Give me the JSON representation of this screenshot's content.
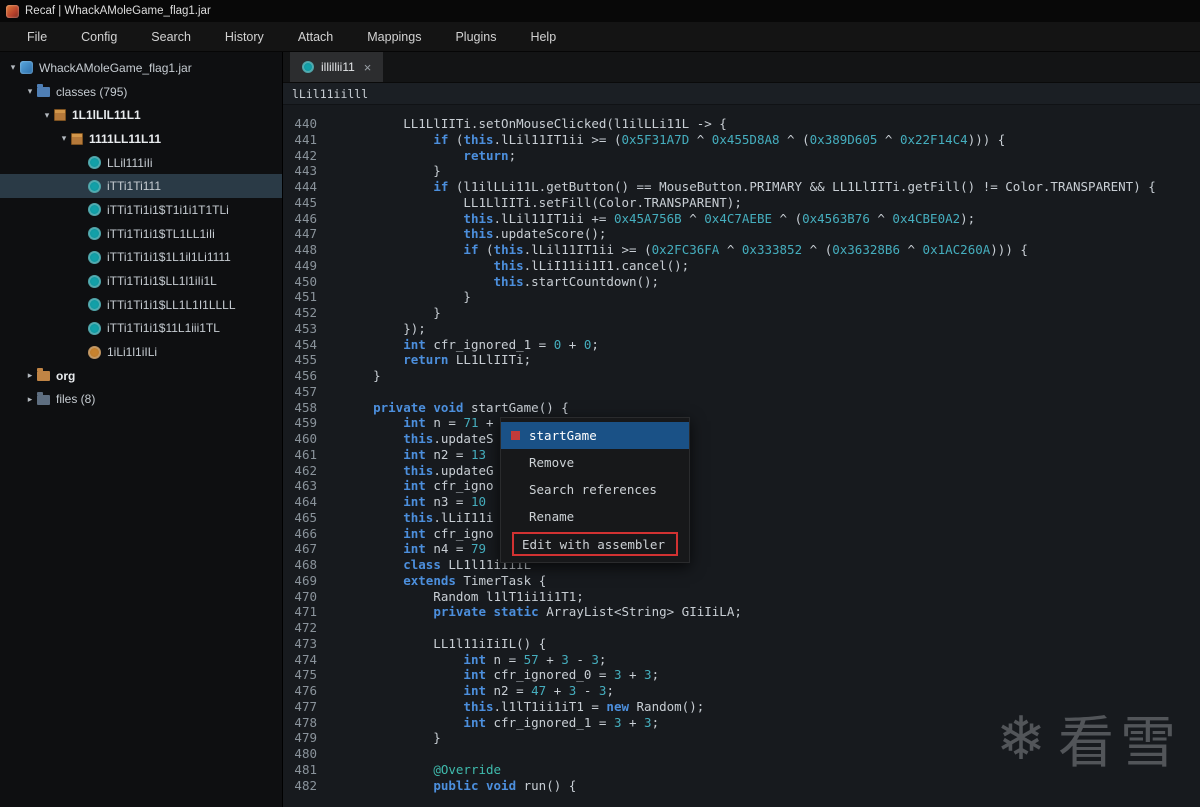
{
  "titlebar": {
    "title": "Recaf | WhackAMoleGame_flag1.jar"
  },
  "menubar": {
    "items": [
      "File",
      "Config",
      "Search",
      "History",
      "Attach",
      "Mappings",
      "Plugins",
      "Help"
    ]
  },
  "icons": {
    "expanded": "▾",
    "collapsed": "▸",
    "tab_close": "×"
  },
  "sidebar": {
    "items": [
      {
        "label": "WhackAMoleGame_flag1.jar",
        "level": 0,
        "icon": "jar",
        "state": "expanded"
      },
      {
        "label": "classes (795)",
        "level": 1,
        "icon": "folder-classes",
        "state": "expanded"
      },
      {
        "label": "1L1lLlL11L1",
        "level": 2,
        "icon": "package",
        "state": "expanded",
        "bold": true
      },
      {
        "label": "1111LL11L11",
        "level": 3,
        "icon": "package",
        "state": "expanded",
        "bold": true
      },
      {
        "label": "LLil111iIi",
        "level": 4,
        "icon": "class"
      },
      {
        "label": "iTTi1Ti111",
        "level": 4,
        "icon": "class",
        "selected": true
      },
      {
        "label": "iTTi1Ti1i1$T1i1i1T1TLi",
        "level": 4,
        "icon": "class"
      },
      {
        "label": "iTTi1Ti1i1$TL1LL1iIi",
        "level": 4,
        "icon": "class"
      },
      {
        "label": "iTTi1Ti1i1$1L1il1Li1111",
        "level": 4,
        "icon": "class"
      },
      {
        "label": "iTTi1Ti1i1$LL1l1iIi1L",
        "level": 4,
        "icon": "class"
      },
      {
        "label": "iTTi1Ti1i1$LL1L1I1LLLL",
        "level": 4,
        "icon": "class"
      },
      {
        "label": "iTTi1Ti1i1$11L1iii1TL",
        "level": 4,
        "icon": "class"
      },
      {
        "label": "1iLi1l1iILi",
        "level": 4,
        "icon": "class-orange"
      },
      {
        "label": "org",
        "level": 1,
        "icon": "folder-org",
        "state": "collapsed",
        "bold": true
      },
      {
        "label": "files (8)",
        "level": 1,
        "icon": "folder-files",
        "state": "collapsed"
      }
    ]
  },
  "tab": {
    "label": "illillii11"
  },
  "breadcrumb": {
    "path": "lLil11iilll"
  },
  "editor": {
    "lines": [
      {
        "n": 440,
        "t": [
          [
            "p",
            "        LL1LlIITi.setOnMouseClicked(l1ilLLi11L -> {"
          ]
        ]
      },
      {
        "n": 441,
        "t": [
          [
            "p",
            "            "
          ],
          [
            "k",
            "if"
          ],
          [
            "p",
            " ("
          ],
          [
            "k",
            "this"
          ],
          [
            "p",
            ".lLil11IT1ii >= ("
          ],
          [
            "n",
            "0x5F31A7D"
          ],
          [
            "p",
            " ^ "
          ],
          [
            "n",
            "0x455D8A8"
          ],
          [
            "p",
            " ^ ("
          ],
          [
            "n",
            "0x389D605"
          ],
          [
            "p",
            " ^ "
          ],
          [
            "n",
            "0x22F14C4"
          ],
          [
            "p",
            "))) {"
          ]
        ]
      },
      {
        "n": 442,
        "t": [
          [
            "p",
            "                "
          ],
          [
            "k",
            "return"
          ],
          [
            "p",
            ";"
          ]
        ]
      },
      {
        "n": 443,
        "t": [
          [
            "p",
            "            }"
          ]
        ]
      },
      {
        "n": 444,
        "t": [
          [
            "p",
            "            "
          ],
          [
            "k",
            "if"
          ],
          [
            "p",
            " (l1ilLLi11L.getButton() == MouseButton.PRIMARY && LL1LlIITi.getFill() != Color.TRANSPARENT) {"
          ]
        ]
      },
      {
        "n": 445,
        "t": [
          [
            "p",
            "                LL1LlIITi.setFill(Color.TRANSPARENT);"
          ]
        ]
      },
      {
        "n": 446,
        "t": [
          [
            "p",
            "                "
          ],
          [
            "k",
            "this"
          ],
          [
            "p",
            ".lLil11IT1ii += "
          ],
          [
            "n",
            "0x45A756B"
          ],
          [
            "p",
            " ^ "
          ],
          [
            "n",
            "0x4C7AEBE"
          ],
          [
            "p",
            " ^ ("
          ],
          [
            "n",
            "0x4563B76"
          ],
          [
            "p",
            " ^ "
          ],
          [
            "n",
            "0x4CBE0A2"
          ],
          [
            "p",
            ");"
          ]
        ]
      },
      {
        "n": 447,
        "t": [
          [
            "p",
            "                "
          ],
          [
            "k",
            "this"
          ],
          [
            "p",
            ".updateScore();"
          ]
        ]
      },
      {
        "n": 448,
        "t": [
          [
            "p",
            "                "
          ],
          [
            "k",
            "if"
          ],
          [
            "p",
            " ("
          ],
          [
            "k",
            "this"
          ],
          [
            "p",
            ".lLil11IT1ii >= ("
          ],
          [
            "n",
            "0x2FC36FA"
          ],
          [
            "p",
            " ^ "
          ],
          [
            "n",
            "0x333852"
          ],
          [
            "p",
            " ^ ("
          ],
          [
            "n",
            "0x36328B6"
          ],
          [
            "p",
            " ^ "
          ],
          [
            "n",
            "0x1AC260A"
          ],
          [
            "p",
            "))) {"
          ]
        ]
      },
      {
        "n": 449,
        "t": [
          [
            "p",
            "                    "
          ],
          [
            "k",
            "this"
          ],
          [
            "p",
            ".lLiI11ii1I1.cancel();"
          ]
        ]
      },
      {
        "n": 450,
        "t": [
          [
            "p",
            "                    "
          ],
          [
            "k",
            "this"
          ],
          [
            "p",
            ".startCountdown();"
          ]
        ]
      },
      {
        "n": 451,
        "t": [
          [
            "p",
            "                }"
          ]
        ]
      },
      {
        "n": 452,
        "t": [
          [
            "p",
            "            }"
          ]
        ]
      },
      {
        "n": 453,
        "t": [
          [
            "p",
            "        });"
          ]
        ]
      },
      {
        "n": 454,
        "t": [
          [
            "p",
            "        "
          ],
          [
            "k",
            "int"
          ],
          [
            "p",
            " cfr_ignored_1 = "
          ],
          [
            "n",
            "0"
          ],
          [
            "p",
            " + "
          ],
          [
            "n",
            "0"
          ],
          [
            "p",
            ";"
          ]
        ]
      },
      {
        "n": 455,
        "t": [
          [
            "p",
            "        "
          ],
          [
            "k",
            "return"
          ],
          [
            "p",
            " LL1LlIITi;"
          ]
        ]
      },
      {
        "n": 456,
        "t": [
          [
            "p",
            "    }"
          ]
        ]
      },
      {
        "n": 457,
        "t": []
      },
      {
        "n": 458,
        "t": [
          [
            "p",
            "    "
          ],
          [
            "k",
            "private"
          ],
          [
            "p",
            " "
          ],
          [
            "k",
            "void"
          ],
          [
            "p",
            " startGame() {"
          ]
        ]
      },
      {
        "n": 459,
        "t": [
          [
            "p",
            "        "
          ],
          [
            "k",
            "int"
          ],
          [
            "p",
            " n = "
          ],
          [
            "n",
            "71"
          ],
          [
            "p",
            " + "
          ]
        ]
      },
      {
        "n": 460,
        "t": [
          [
            "p",
            "        "
          ],
          [
            "k",
            "this"
          ],
          [
            "p",
            ".updateS"
          ]
        ]
      },
      {
        "n": 461,
        "t": [
          [
            "p",
            "        "
          ],
          [
            "k",
            "int"
          ],
          [
            "p",
            " n2 = "
          ],
          [
            "n",
            "13"
          ]
        ]
      },
      {
        "n": 462,
        "t": [
          [
            "p",
            "        "
          ],
          [
            "k",
            "this"
          ],
          [
            "p",
            ".updateG"
          ]
        ]
      },
      {
        "n": 463,
        "t": [
          [
            "p",
            "        "
          ],
          [
            "k",
            "int"
          ],
          [
            "p",
            " cfr_igno"
          ]
        ]
      },
      {
        "n": 464,
        "t": [
          [
            "p",
            "        "
          ],
          [
            "k",
            "int"
          ],
          [
            "p",
            " n3 = "
          ],
          [
            "n",
            "10"
          ]
        ]
      },
      {
        "n": 465,
        "t": [
          [
            "p",
            "        "
          ],
          [
            "k",
            "this"
          ],
          [
            "p",
            ".lLiI11i"
          ]
        ]
      },
      {
        "n": 466,
        "t": [
          [
            "p",
            "        "
          ],
          [
            "k",
            "int"
          ],
          [
            "p",
            " cfr_igno"
          ]
        ]
      },
      {
        "n": 467,
        "t": [
          [
            "p",
            "        "
          ],
          [
            "k",
            "int"
          ],
          [
            "p",
            " n4 = "
          ],
          [
            "n",
            "79"
          ]
        ]
      },
      {
        "n": 468,
        "t": [
          [
            "p",
            "        "
          ],
          [
            "k",
            "class"
          ],
          [
            "p",
            " LL1l11iIiIL"
          ]
        ]
      },
      {
        "n": 469,
        "t": [
          [
            "p",
            "        "
          ],
          [
            "k",
            "extends"
          ],
          [
            "p",
            " TimerTask {"
          ]
        ]
      },
      {
        "n": 470,
        "t": [
          [
            "p",
            "            Random l1lT1ii1i1T1;"
          ]
        ]
      },
      {
        "n": 471,
        "t": [
          [
            "p",
            "            "
          ],
          [
            "k",
            "private"
          ],
          [
            "p",
            " "
          ],
          [
            "k",
            "static"
          ],
          [
            "p",
            " ArrayList<String> GIiIiLA;"
          ]
        ]
      },
      {
        "n": 472,
        "t": []
      },
      {
        "n": 473,
        "t": [
          [
            "p",
            "            LL1l11iIiIL() {"
          ]
        ]
      },
      {
        "n": 474,
        "t": [
          [
            "p",
            "                "
          ],
          [
            "k",
            "int"
          ],
          [
            "p",
            " n = "
          ],
          [
            "n",
            "57"
          ],
          [
            "p",
            " + "
          ],
          [
            "n",
            "3"
          ],
          [
            "p",
            " - "
          ],
          [
            "n",
            "3"
          ],
          [
            "p",
            ";"
          ]
        ]
      },
      {
        "n": 475,
        "t": [
          [
            "p",
            "                "
          ],
          [
            "k",
            "int"
          ],
          [
            "p",
            " cfr_ignored_0 = "
          ],
          [
            "n",
            "3"
          ],
          [
            "p",
            " + "
          ],
          [
            "n",
            "3"
          ],
          [
            "p",
            ";"
          ]
        ]
      },
      {
        "n": 476,
        "t": [
          [
            "p",
            "                "
          ],
          [
            "k",
            "int"
          ],
          [
            "p",
            " n2 = "
          ],
          [
            "n",
            "47"
          ],
          [
            "p",
            " + "
          ],
          [
            "n",
            "3"
          ],
          [
            "p",
            " - "
          ],
          [
            "n",
            "3"
          ],
          [
            "p",
            ";"
          ]
        ]
      },
      {
        "n": 477,
        "t": [
          [
            "p",
            "                "
          ],
          [
            "k",
            "this"
          ],
          [
            "p",
            ".l1lT1ii1iT1 = "
          ],
          [
            "k",
            "new"
          ],
          [
            "p",
            " Random();"
          ]
        ]
      },
      {
        "n": 478,
        "t": [
          [
            "p",
            "                "
          ],
          [
            "k",
            "int"
          ],
          [
            "p",
            " cfr_ignored_1 = "
          ],
          [
            "n",
            "3"
          ],
          [
            "p",
            " + "
          ],
          [
            "n",
            "3"
          ],
          [
            "p",
            ";"
          ]
        ]
      },
      {
        "n": 479,
        "t": [
          [
            "p",
            "            }"
          ]
        ]
      },
      {
        "n": 480,
        "t": []
      },
      {
        "n": 481,
        "t": [
          [
            "p",
            "            "
          ],
          [
            "a",
            "@Override"
          ]
        ]
      },
      {
        "n": 482,
        "t": [
          [
            "p",
            "            "
          ],
          [
            "k",
            "public"
          ],
          [
            "p",
            " "
          ],
          [
            "k",
            "void"
          ],
          [
            "p",
            " run() {"
          ]
        ]
      }
    ]
  },
  "context_menu": {
    "items": [
      {
        "label": "startGame",
        "selected": true,
        "icon": "method"
      },
      {
        "label": "Remove"
      },
      {
        "label": "Search references"
      },
      {
        "label": "Rename"
      },
      {
        "label": "Edit with assembler",
        "outlined": true
      }
    ]
  },
  "watermark": {
    "snowflake": "❄",
    "text": "看雪"
  }
}
